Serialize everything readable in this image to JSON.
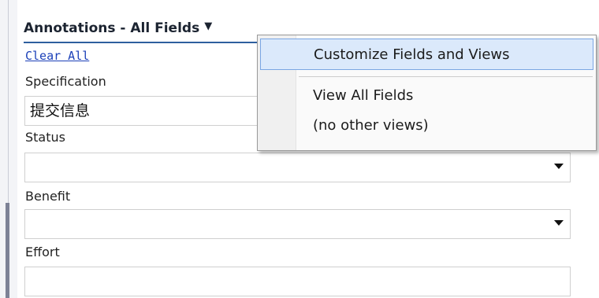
{
  "panel": {
    "title": "Annotations - All Fields",
    "dropdown_arrow": "▼",
    "clear_all": "Clear All"
  },
  "fields": [
    {
      "label": "Specification",
      "value": "提交信息",
      "type": "text"
    },
    {
      "label": "Status",
      "value": "",
      "type": "select"
    },
    {
      "label": "Benefit",
      "value": "",
      "type": "select"
    },
    {
      "label": "Effort",
      "value": "",
      "type": "text"
    }
  ],
  "menu": {
    "items": [
      "Customize Fields and Views",
      "View All Fields"
    ],
    "note": "(no other views)"
  },
  "colors": {
    "accent_line": "#2e5f9e",
    "link": "#1a3fb8",
    "menu_highlight": "#dbe9fb"
  }
}
